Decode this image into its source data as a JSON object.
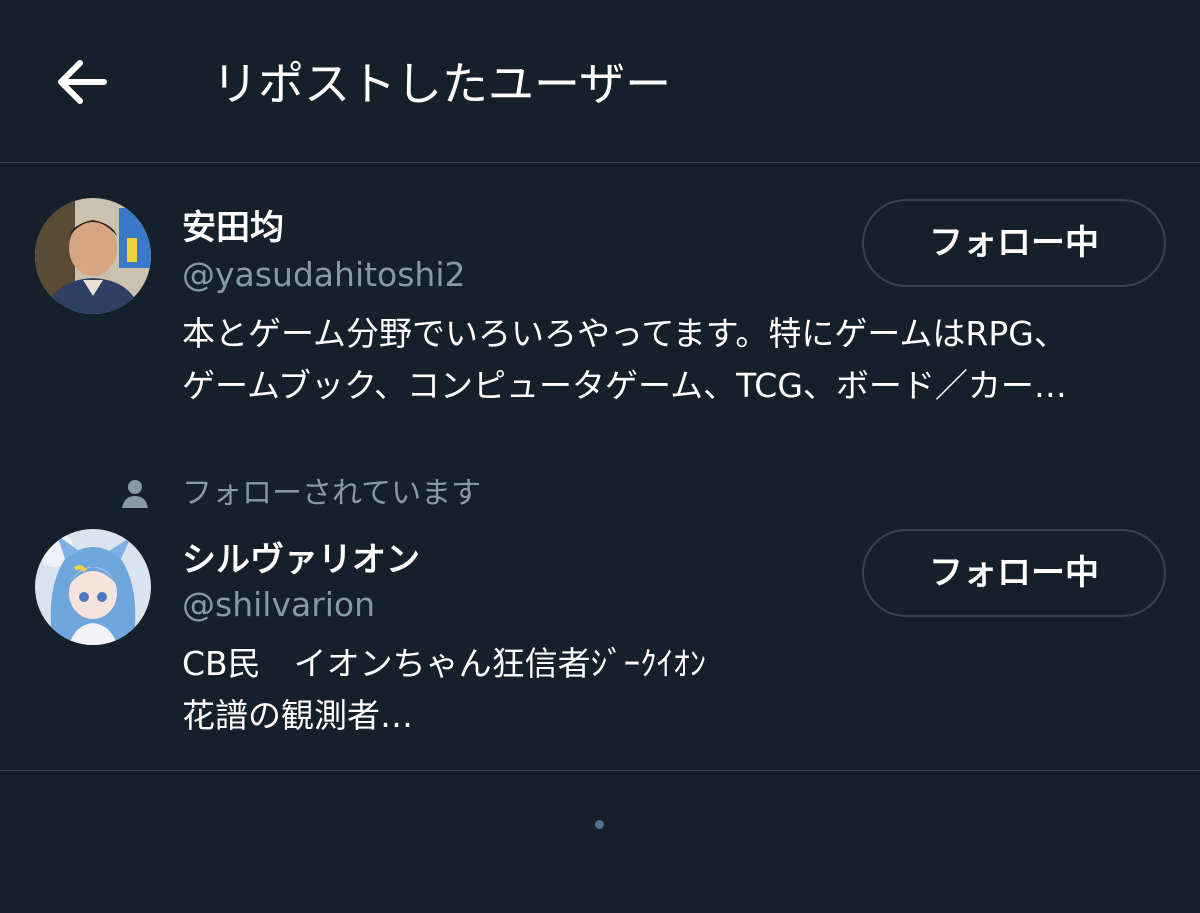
{
  "header": {
    "title": "リポストしたユーザー",
    "back_icon": "arrow-left-icon"
  },
  "users": [
    {
      "name": "安田均",
      "handle": "@yasudahitoshi2",
      "bio_line1": "本とゲーム分野でいろいろやってます。特にゲームはRPG、",
      "bio_line2": "ゲームブック、コンピュータゲーム、TCG、ボード／カー…",
      "follow_label": "フォロー中"
    },
    {
      "follows_you": "フォローされています",
      "name": "シルヴァリオン",
      "handle": "@shilvarion",
      "bio_line1": "CB民　イオンちゃん狂信者ｼﾞｰｸｲｵﾝ",
      "bio_line2": "花譜の観測者…",
      "follow_label": "フォロー中"
    }
  ],
  "colors": {
    "background": "#15202b",
    "divider": "#38444d",
    "secondary_text": "#8899a6",
    "primary_text": "#ffffff"
  }
}
